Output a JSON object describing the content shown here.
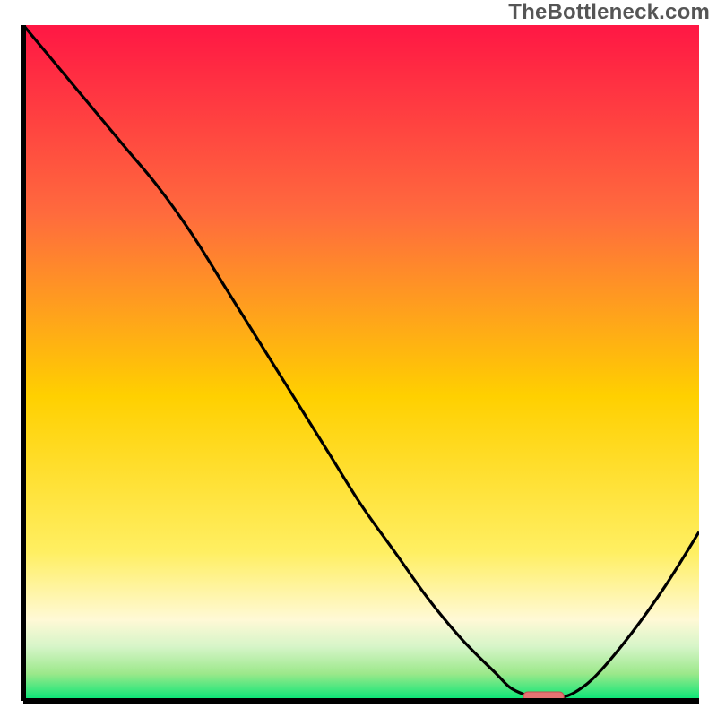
{
  "watermark": "TheBottleneck.com",
  "colors": {
    "gradient_top": "#ff1744",
    "gradient_mid_upper": "#ff6b3d",
    "gradient_mid": "#ffd000",
    "gradient_mid_lower": "#ffef62",
    "gradient_low_cream": "#fff9d6",
    "gradient_pale_green": "#d6f5c8",
    "gradient_light_green": "#9be88a",
    "gradient_green": "#00e676",
    "axis": "#000000",
    "curve": "#000000",
    "marker_fill": "#e57373",
    "marker_stroke": "#c05050"
  },
  "chart_data": {
    "type": "line",
    "title": "",
    "xlabel": "",
    "ylabel": "",
    "xlim": [
      0,
      100
    ],
    "ylim": [
      0,
      100
    ],
    "x": [
      0,
      5,
      10,
      15,
      20,
      25,
      30,
      35,
      40,
      45,
      50,
      55,
      60,
      65,
      70,
      72,
      74,
      76,
      78,
      80,
      82,
      85,
      90,
      95,
      100
    ],
    "y": [
      100,
      94,
      88,
      82,
      76,
      69,
      61,
      53,
      45,
      37,
      29,
      22,
      15,
      9,
      4,
      2,
      1,
      0.5,
      0.5,
      0.6,
      1.5,
      4,
      10,
      17,
      25
    ],
    "marker": {
      "x_center": 77,
      "width": 6,
      "y": 0.6
    },
    "annotations": []
  }
}
